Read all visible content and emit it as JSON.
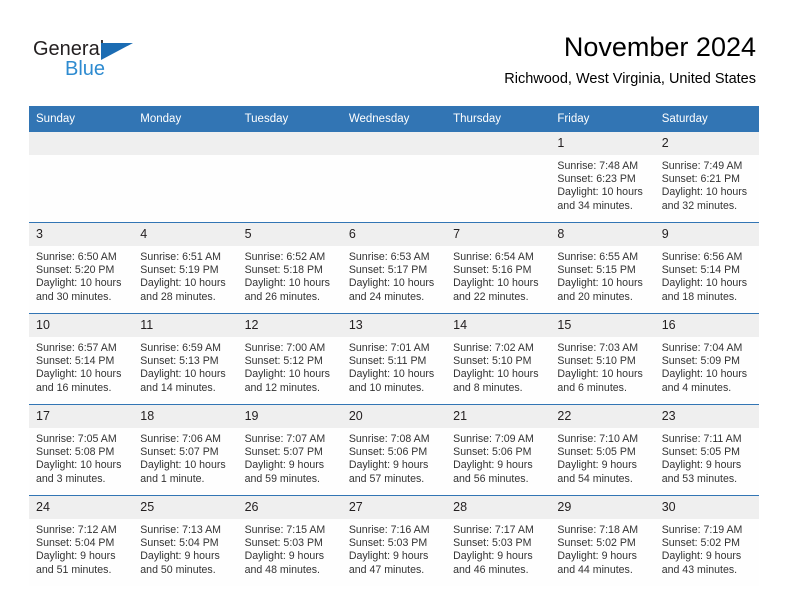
{
  "brand": {
    "name_part1": "General",
    "name_part2": "Blue",
    "triangle_icon": "triangle-icon",
    "accent_dark": "#1b6cb3",
    "accent_light": "#2e8bd0"
  },
  "header": {
    "month_title": "November 2024",
    "location": "Richwood, West Virginia, United States"
  },
  "theme": {
    "header_blue": "#3275b4",
    "daynum_bg": "#efefef",
    "text": "#333333"
  },
  "weekdays": [
    "Sunday",
    "Monday",
    "Tuesday",
    "Wednesday",
    "Thursday",
    "Friday",
    "Saturday"
  ],
  "labels": {
    "sunrise": "Sunrise:",
    "sunset": "Sunset:",
    "daylight": "Daylight:"
  },
  "weeks": [
    [
      {
        "day": "",
        "empty": true
      },
      {
        "day": "",
        "empty": true
      },
      {
        "day": "",
        "empty": true
      },
      {
        "day": "",
        "empty": true
      },
      {
        "day": "",
        "empty": true
      },
      {
        "day": "1",
        "sunrise": "Sunrise: 7:48 AM",
        "sunset": "Sunset: 6:23 PM",
        "daylight_line1": "Daylight: 10 hours",
        "daylight_line2": "and 34 minutes."
      },
      {
        "day": "2",
        "sunrise": "Sunrise: 7:49 AM",
        "sunset": "Sunset: 6:21 PM",
        "daylight_line1": "Daylight: 10 hours",
        "daylight_line2": "and 32 minutes."
      }
    ],
    [
      {
        "day": "3",
        "sunrise": "Sunrise: 6:50 AM",
        "sunset": "Sunset: 5:20 PM",
        "daylight_line1": "Daylight: 10 hours",
        "daylight_line2": "and 30 minutes."
      },
      {
        "day": "4",
        "sunrise": "Sunrise: 6:51 AM",
        "sunset": "Sunset: 5:19 PM",
        "daylight_line1": "Daylight: 10 hours",
        "daylight_line2": "and 28 minutes."
      },
      {
        "day": "5",
        "sunrise": "Sunrise: 6:52 AM",
        "sunset": "Sunset: 5:18 PM",
        "daylight_line1": "Daylight: 10 hours",
        "daylight_line2": "and 26 minutes."
      },
      {
        "day": "6",
        "sunrise": "Sunrise: 6:53 AM",
        "sunset": "Sunset: 5:17 PM",
        "daylight_line1": "Daylight: 10 hours",
        "daylight_line2": "and 24 minutes."
      },
      {
        "day": "7",
        "sunrise": "Sunrise: 6:54 AM",
        "sunset": "Sunset: 5:16 PM",
        "daylight_line1": "Daylight: 10 hours",
        "daylight_line2": "and 22 minutes."
      },
      {
        "day": "8",
        "sunrise": "Sunrise: 6:55 AM",
        "sunset": "Sunset: 5:15 PM",
        "daylight_line1": "Daylight: 10 hours",
        "daylight_line2": "and 20 minutes."
      },
      {
        "day": "9",
        "sunrise": "Sunrise: 6:56 AM",
        "sunset": "Sunset: 5:14 PM",
        "daylight_line1": "Daylight: 10 hours",
        "daylight_line2": "and 18 minutes."
      }
    ],
    [
      {
        "day": "10",
        "sunrise": "Sunrise: 6:57 AM",
        "sunset": "Sunset: 5:14 PM",
        "daylight_line1": "Daylight: 10 hours",
        "daylight_line2": "and 16 minutes."
      },
      {
        "day": "11",
        "sunrise": "Sunrise: 6:59 AM",
        "sunset": "Sunset: 5:13 PM",
        "daylight_line1": "Daylight: 10 hours",
        "daylight_line2": "and 14 minutes."
      },
      {
        "day": "12",
        "sunrise": "Sunrise: 7:00 AM",
        "sunset": "Sunset: 5:12 PM",
        "daylight_line1": "Daylight: 10 hours",
        "daylight_line2": "and 12 minutes."
      },
      {
        "day": "13",
        "sunrise": "Sunrise: 7:01 AM",
        "sunset": "Sunset: 5:11 PM",
        "daylight_line1": "Daylight: 10 hours",
        "daylight_line2": "and 10 minutes."
      },
      {
        "day": "14",
        "sunrise": "Sunrise: 7:02 AM",
        "sunset": "Sunset: 5:10 PM",
        "daylight_line1": "Daylight: 10 hours",
        "daylight_line2": "and 8 minutes."
      },
      {
        "day": "15",
        "sunrise": "Sunrise: 7:03 AM",
        "sunset": "Sunset: 5:10 PM",
        "daylight_line1": "Daylight: 10 hours",
        "daylight_line2": "and 6 minutes."
      },
      {
        "day": "16",
        "sunrise": "Sunrise: 7:04 AM",
        "sunset": "Sunset: 5:09 PM",
        "daylight_line1": "Daylight: 10 hours",
        "daylight_line2": "and 4 minutes."
      }
    ],
    [
      {
        "day": "17",
        "sunrise": "Sunrise: 7:05 AM",
        "sunset": "Sunset: 5:08 PM",
        "daylight_line1": "Daylight: 10 hours",
        "daylight_line2": "and 3 minutes."
      },
      {
        "day": "18",
        "sunrise": "Sunrise: 7:06 AM",
        "sunset": "Sunset: 5:07 PM",
        "daylight_line1": "Daylight: 10 hours",
        "daylight_line2": "and 1 minute."
      },
      {
        "day": "19",
        "sunrise": "Sunrise: 7:07 AM",
        "sunset": "Sunset: 5:07 PM",
        "daylight_line1": "Daylight: 9 hours",
        "daylight_line2": "and 59 minutes."
      },
      {
        "day": "20",
        "sunrise": "Sunrise: 7:08 AM",
        "sunset": "Sunset: 5:06 PM",
        "daylight_line1": "Daylight: 9 hours",
        "daylight_line2": "and 57 minutes."
      },
      {
        "day": "21",
        "sunrise": "Sunrise: 7:09 AM",
        "sunset": "Sunset: 5:06 PM",
        "daylight_line1": "Daylight: 9 hours",
        "daylight_line2": "and 56 minutes."
      },
      {
        "day": "22",
        "sunrise": "Sunrise: 7:10 AM",
        "sunset": "Sunset: 5:05 PM",
        "daylight_line1": "Daylight: 9 hours",
        "daylight_line2": "and 54 minutes."
      },
      {
        "day": "23",
        "sunrise": "Sunrise: 7:11 AM",
        "sunset": "Sunset: 5:05 PM",
        "daylight_line1": "Daylight: 9 hours",
        "daylight_line2": "and 53 minutes."
      }
    ],
    [
      {
        "day": "24",
        "sunrise": "Sunrise: 7:12 AM",
        "sunset": "Sunset: 5:04 PM",
        "daylight_line1": "Daylight: 9 hours",
        "daylight_line2": "and 51 minutes."
      },
      {
        "day": "25",
        "sunrise": "Sunrise: 7:13 AM",
        "sunset": "Sunset: 5:04 PM",
        "daylight_line1": "Daylight: 9 hours",
        "daylight_line2": "and 50 minutes."
      },
      {
        "day": "26",
        "sunrise": "Sunrise: 7:15 AM",
        "sunset": "Sunset: 5:03 PM",
        "daylight_line1": "Daylight: 9 hours",
        "daylight_line2": "and 48 minutes."
      },
      {
        "day": "27",
        "sunrise": "Sunrise: 7:16 AM",
        "sunset": "Sunset: 5:03 PM",
        "daylight_line1": "Daylight: 9 hours",
        "daylight_line2": "and 47 minutes."
      },
      {
        "day": "28",
        "sunrise": "Sunrise: 7:17 AM",
        "sunset": "Sunset: 5:03 PM",
        "daylight_line1": "Daylight: 9 hours",
        "daylight_line2": "and 46 minutes."
      },
      {
        "day": "29",
        "sunrise": "Sunrise: 7:18 AM",
        "sunset": "Sunset: 5:02 PM",
        "daylight_line1": "Daylight: 9 hours",
        "daylight_line2": "and 44 minutes."
      },
      {
        "day": "30",
        "sunrise": "Sunrise: 7:19 AM",
        "sunset": "Sunset: 5:02 PM",
        "daylight_line1": "Daylight: 9 hours",
        "daylight_line2": "and 43 minutes."
      }
    ]
  ]
}
